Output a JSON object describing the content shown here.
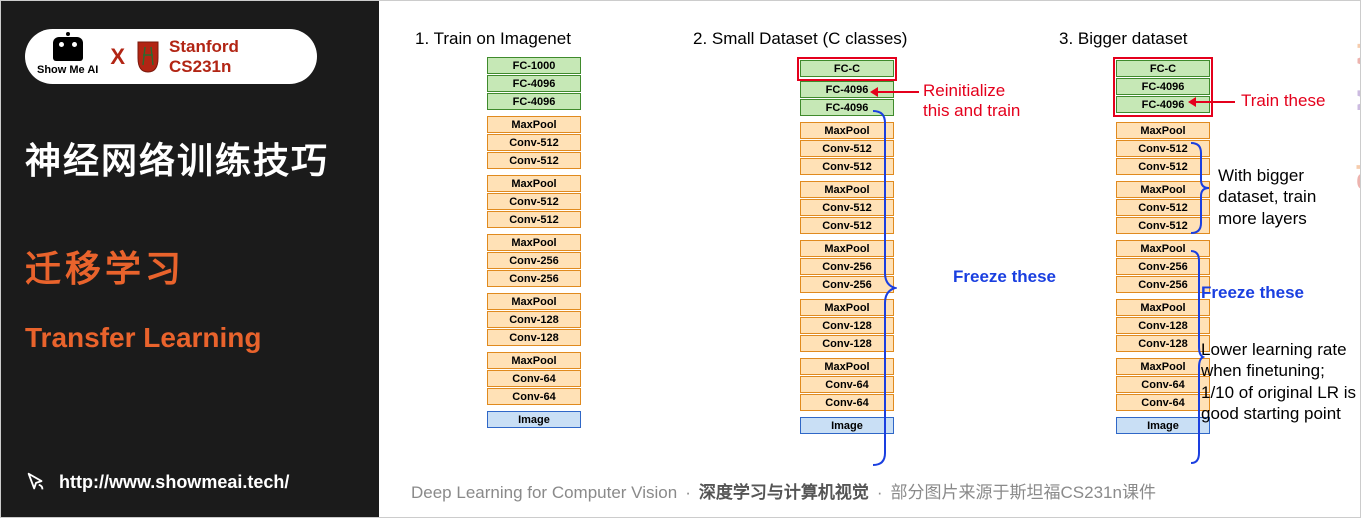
{
  "sidebar": {
    "brand_showmeai": "Show Me AI",
    "brand_x": "X",
    "brand_university": "Stanford",
    "brand_course": "CS231n",
    "title_cn": "神经网络训练技巧",
    "subtitle_cn": "迁移学习",
    "subtitle_en": "Transfer Learning",
    "url": "http://www.showmeai.tech/"
  },
  "columns": [
    {
      "title": "1. Train on Imagenet",
      "highlight": "none",
      "layers": [
        [
          "FC-1000",
          "fc"
        ],
        [
          "FC-4096",
          "fc"
        ],
        [
          "FC-4096",
          "fc"
        ],
        "gap",
        [
          "MaxPool",
          "mp"
        ],
        [
          "Conv-512",
          "conv"
        ],
        [
          "Conv-512",
          "conv"
        ],
        "gap",
        [
          "MaxPool",
          "mp"
        ],
        [
          "Conv-512",
          "conv"
        ],
        [
          "Conv-512",
          "conv"
        ],
        "gap",
        [
          "MaxPool",
          "mp"
        ],
        [
          "Conv-256",
          "conv"
        ],
        [
          "Conv-256",
          "conv"
        ],
        "gap",
        [
          "MaxPool",
          "mp"
        ],
        [
          "Conv-128",
          "conv"
        ],
        [
          "Conv-128",
          "conv"
        ],
        "gap",
        [
          "MaxPool",
          "mp"
        ],
        [
          "Conv-64",
          "conv"
        ],
        [
          "Conv-64",
          "conv"
        ],
        "gap",
        [
          "Image",
          "img"
        ]
      ]
    },
    {
      "title": "2. Small Dataset (C classes)",
      "highlight": "top1",
      "layers": [
        [
          "FC-C",
          "fc"
        ],
        [
          "FC-4096",
          "fc"
        ],
        [
          "FC-4096",
          "fc"
        ],
        "gap",
        [
          "MaxPool",
          "mp"
        ],
        [
          "Conv-512",
          "conv"
        ],
        [
          "Conv-512",
          "conv"
        ],
        "gap",
        [
          "MaxPool",
          "mp"
        ],
        [
          "Conv-512",
          "conv"
        ],
        [
          "Conv-512",
          "conv"
        ],
        "gap",
        [
          "MaxPool",
          "mp"
        ],
        [
          "Conv-256",
          "conv"
        ],
        [
          "Conv-256",
          "conv"
        ],
        "gap",
        [
          "MaxPool",
          "mp"
        ],
        [
          "Conv-128",
          "conv"
        ],
        [
          "Conv-128",
          "conv"
        ],
        "gap",
        [
          "MaxPool",
          "mp"
        ],
        [
          "Conv-64",
          "conv"
        ],
        [
          "Conv-64",
          "conv"
        ],
        "gap",
        [
          "Image",
          "img"
        ]
      ],
      "ann_reinit": "Reinitialize\nthis and train",
      "ann_freeze": "Freeze these"
    },
    {
      "title": "3. Bigger dataset",
      "highlight": "top3",
      "layers": [
        [
          "FC-C",
          "fc"
        ],
        [
          "FC-4096",
          "fc"
        ],
        [
          "FC-4096",
          "fc"
        ],
        "gap",
        [
          "MaxPool",
          "mp"
        ],
        [
          "Conv-512",
          "conv"
        ],
        [
          "Conv-512",
          "conv"
        ],
        "gap",
        [
          "MaxPool",
          "mp"
        ],
        [
          "Conv-512",
          "conv"
        ],
        [
          "Conv-512",
          "conv"
        ],
        "gap",
        [
          "MaxPool",
          "mp"
        ],
        [
          "Conv-256",
          "conv"
        ],
        [
          "Conv-256",
          "conv"
        ],
        "gap",
        [
          "MaxPool",
          "mp"
        ],
        [
          "Conv-128",
          "conv"
        ],
        [
          "Conv-128",
          "conv"
        ],
        "gap",
        [
          "MaxPool",
          "mp"
        ],
        [
          "Conv-64",
          "conv"
        ],
        [
          "Conv-64",
          "conv"
        ],
        "gap",
        [
          "Image",
          "img"
        ]
      ],
      "ann_train": "Train these",
      "ann_bigger": "With bigger\ndataset, train\nmore layers",
      "ann_freeze": "Freeze these",
      "ann_lr": "Lower learning rate when finetuning; 1/10 of original LR is good starting point"
    }
  ],
  "footer": {
    "part1": "Deep Learning for Computer Vision",
    "dot": "·",
    "part2": "深度学习与计算机视觉",
    "part3": "部分图片来源于斯坦福CS231n课件"
  },
  "watermark": "ShowMeAI",
  "colors": {
    "accent_orange": "#e9632c",
    "accent_red": "#e4001c",
    "accent_blue": "#1a3fe0",
    "fc_bg": "#c6e8b6",
    "conv_bg": "#ffe1b6",
    "img_bg": "#c9dff5"
  }
}
